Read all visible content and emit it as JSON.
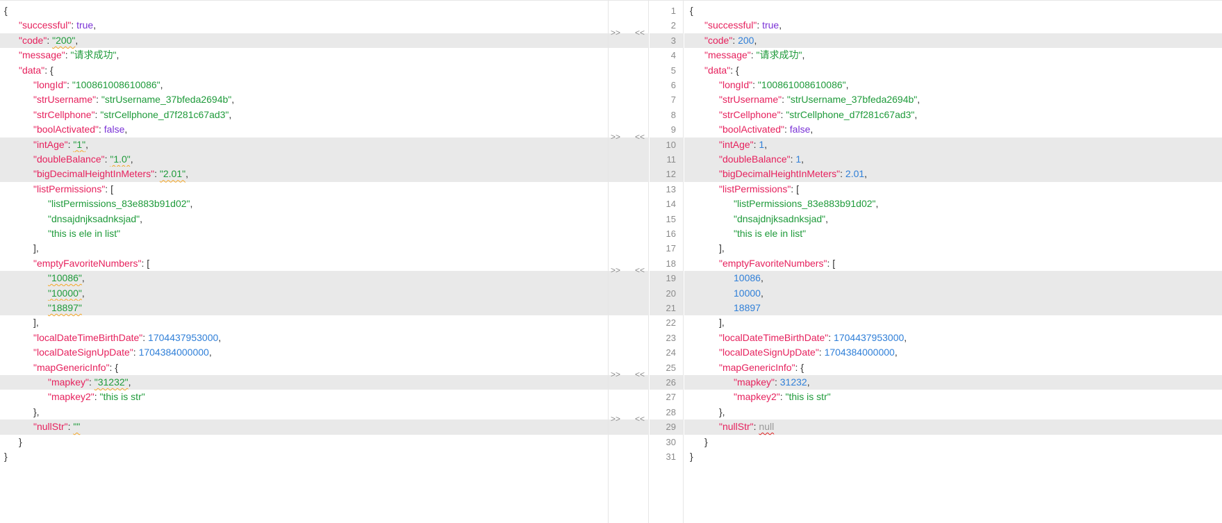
{
  "left_lines": [
    [
      {
        "t": "p",
        "v": "{"
      }
    ],
    [
      {
        "t": "k",
        "v": "\"successful\""
      },
      {
        "t": "p",
        "v": ": "
      },
      {
        "t": "b",
        "v": "true"
      },
      {
        "t": "p",
        "v": ","
      }
    ],
    [
      {
        "t": "k",
        "v": "\"code\""
      },
      {
        "t": "p",
        "v": ": "
      },
      {
        "t": "s",
        "v": "\"200\"",
        "e": "orange"
      },
      {
        "t": "p",
        "v": ","
      }
    ],
    [
      {
        "t": "k",
        "v": "\"message\""
      },
      {
        "t": "p",
        "v": ": "
      },
      {
        "t": "s",
        "v": "\"请求成功\""
      },
      {
        "t": "p",
        "v": ","
      }
    ],
    [
      {
        "t": "k",
        "v": "\"data\""
      },
      {
        "t": "p",
        "v": ": {"
      }
    ],
    [
      {
        "t": "k",
        "v": "\"longId\""
      },
      {
        "t": "p",
        "v": ": "
      },
      {
        "t": "s",
        "v": "\"100861008610086\""
      },
      {
        "t": "p",
        "v": ","
      }
    ],
    [
      {
        "t": "k",
        "v": "\"strUsername\""
      },
      {
        "t": "p",
        "v": ": "
      },
      {
        "t": "s",
        "v": "\"strUsername_37bfeda2694b\""
      },
      {
        "t": "p",
        "v": ","
      }
    ],
    [
      {
        "t": "k",
        "v": "\"strCellphone\""
      },
      {
        "t": "p",
        "v": ": "
      },
      {
        "t": "s",
        "v": "\"strCellphone_d7f281c67ad3\""
      },
      {
        "t": "p",
        "v": ","
      }
    ],
    [
      {
        "t": "k",
        "v": "\"boolActivated\""
      },
      {
        "t": "p",
        "v": ": "
      },
      {
        "t": "b",
        "v": "false"
      },
      {
        "t": "p",
        "v": ","
      }
    ],
    [
      {
        "t": "k",
        "v": "\"intAge\""
      },
      {
        "t": "p",
        "v": ": "
      },
      {
        "t": "s",
        "v": "\"1\"",
        "e": "orange"
      },
      {
        "t": "p",
        "v": ","
      }
    ],
    [
      {
        "t": "k",
        "v": "\"doubleBalance\""
      },
      {
        "t": "p",
        "v": ": "
      },
      {
        "t": "s",
        "v": "\"1.0\"",
        "e": "orange"
      },
      {
        "t": "p",
        "v": ","
      }
    ],
    [
      {
        "t": "k",
        "v": "\"bigDecimalHeightInMeters\""
      },
      {
        "t": "p",
        "v": ": "
      },
      {
        "t": "s",
        "v": "\"2.01\"",
        "e": "orange"
      },
      {
        "t": "p",
        "v": ","
      }
    ],
    [
      {
        "t": "k",
        "v": "\"listPermissions\""
      },
      {
        "t": "p",
        "v": ": ["
      }
    ],
    [
      {
        "t": "s",
        "v": "\"listPermissions_83e883b91d02\""
      },
      {
        "t": "p",
        "v": ","
      }
    ],
    [
      {
        "t": "s",
        "v": "\"dnsajdnjksadnksjad\""
      },
      {
        "t": "p",
        "v": ","
      }
    ],
    [
      {
        "t": "s",
        "v": "\"this is ele in list\""
      }
    ],
    [
      {
        "t": "p",
        "v": "],"
      }
    ],
    [
      {
        "t": "k",
        "v": "\"emptyFavoriteNumbers\""
      },
      {
        "t": "p",
        "v": ": ["
      }
    ],
    [
      {
        "t": "s",
        "v": "\"10086\"",
        "e": "orange"
      },
      {
        "t": "p",
        "v": ","
      }
    ],
    [
      {
        "t": "s",
        "v": "\"10000\"",
        "e": "orange"
      },
      {
        "t": "p",
        "v": ","
      }
    ],
    [
      {
        "t": "s",
        "v": "\"18897\"",
        "e": "orange"
      }
    ],
    [
      {
        "t": "p",
        "v": "],"
      }
    ],
    [
      {
        "t": "k",
        "v": "\"localDateTimeBirthDate\""
      },
      {
        "t": "p",
        "v": ": "
      },
      {
        "t": "n",
        "v": "1704437953000"
      },
      {
        "t": "p",
        "v": ","
      }
    ],
    [
      {
        "t": "k",
        "v": "\"localDateSignUpDate\""
      },
      {
        "t": "p",
        "v": ": "
      },
      {
        "t": "n",
        "v": "1704384000000"
      },
      {
        "t": "p",
        "v": ","
      }
    ],
    [
      {
        "t": "k",
        "v": "\"mapGenericInfo\""
      },
      {
        "t": "p",
        "v": ": {"
      }
    ],
    [
      {
        "t": "k",
        "v": "\"mapkey\""
      },
      {
        "t": "p",
        "v": ": "
      },
      {
        "t": "s",
        "v": "\"31232\"",
        "e": "orange"
      },
      {
        "t": "p",
        "v": ","
      }
    ],
    [
      {
        "t": "k",
        "v": "\"mapkey2\""
      },
      {
        "t": "p",
        "v": ": "
      },
      {
        "t": "s",
        "v": "\"this is str\""
      }
    ],
    [
      {
        "t": "p",
        "v": "},"
      }
    ],
    [
      {
        "t": "k",
        "v": "\"nullStr\""
      },
      {
        "t": "p",
        "v": ": "
      },
      {
        "t": "s",
        "v": "\"\"",
        "e": "orange"
      }
    ],
    [
      {
        "t": "p",
        "v": "}"
      }
    ],
    [
      {
        "t": "p",
        "v": "}"
      }
    ]
  ],
  "right_lines": [
    [
      {
        "t": "p",
        "v": "{"
      }
    ],
    [
      {
        "t": "k",
        "v": "\"successful\""
      },
      {
        "t": "p",
        "v": ": "
      },
      {
        "t": "b",
        "v": "true"
      },
      {
        "t": "p",
        "v": ","
      }
    ],
    [
      {
        "t": "k",
        "v": "\"code\""
      },
      {
        "t": "p",
        "v": ": "
      },
      {
        "t": "n",
        "v": "200"
      },
      {
        "t": "p",
        "v": ","
      }
    ],
    [
      {
        "t": "k",
        "v": "\"message\""
      },
      {
        "t": "p",
        "v": ": "
      },
      {
        "t": "s",
        "v": "\"请求成功\""
      },
      {
        "t": "p",
        "v": ","
      }
    ],
    [
      {
        "t": "k",
        "v": "\"data\""
      },
      {
        "t": "p",
        "v": ": {"
      }
    ],
    [
      {
        "t": "k",
        "v": "\"longId\""
      },
      {
        "t": "p",
        "v": ": "
      },
      {
        "t": "s",
        "v": "\"100861008610086\""
      },
      {
        "t": "p",
        "v": ","
      }
    ],
    [
      {
        "t": "k",
        "v": "\"strUsername\""
      },
      {
        "t": "p",
        "v": ": "
      },
      {
        "t": "s",
        "v": "\"strUsername_37bfeda2694b\""
      },
      {
        "t": "p",
        "v": ","
      }
    ],
    [
      {
        "t": "k",
        "v": "\"strCellphone\""
      },
      {
        "t": "p",
        "v": ": "
      },
      {
        "t": "s",
        "v": "\"strCellphone_d7f281c67ad3\""
      },
      {
        "t": "p",
        "v": ","
      }
    ],
    [
      {
        "t": "k",
        "v": "\"boolActivated\""
      },
      {
        "t": "p",
        "v": ": "
      },
      {
        "t": "b",
        "v": "false"
      },
      {
        "t": "p",
        "v": ","
      }
    ],
    [
      {
        "t": "k",
        "v": "\"intAge\""
      },
      {
        "t": "p",
        "v": ": "
      },
      {
        "t": "n",
        "v": "1"
      },
      {
        "t": "p",
        "v": ","
      }
    ],
    [
      {
        "t": "k",
        "v": "\"doubleBalance\""
      },
      {
        "t": "p",
        "v": ": "
      },
      {
        "t": "n",
        "v": "1"
      },
      {
        "t": "p",
        "v": ","
      }
    ],
    [
      {
        "t": "k",
        "v": "\"bigDecimalHeightInMeters\""
      },
      {
        "t": "p",
        "v": ": "
      },
      {
        "t": "n",
        "v": "2.01"
      },
      {
        "t": "p",
        "v": ","
      }
    ],
    [
      {
        "t": "k",
        "v": "\"listPermissions\""
      },
      {
        "t": "p",
        "v": ": ["
      }
    ],
    [
      {
        "t": "s",
        "v": "\"listPermissions_83e883b91d02\""
      },
      {
        "t": "p",
        "v": ","
      }
    ],
    [
      {
        "t": "s",
        "v": "\"dnsajdnjksadnksjad\""
      },
      {
        "t": "p",
        "v": ","
      }
    ],
    [
      {
        "t": "s",
        "v": "\"this is ele in list\""
      }
    ],
    [
      {
        "t": "p",
        "v": "],"
      }
    ],
    [
      {
        "t": "k",
        "v": "\"emptyFavoriteNumbers\""
      },
      {
        "t": "p",
        "v": ": ["
      }
    ],
    [
      {
        "t": "n",
        "v": "10086"
      },
      {
        "t": "p",
        "v": ","
      }
    ],
    [
      {
        "t": "n",
        "v": "10000"
      },
      {
        "t": "p",
        "v": ","
      }
    ],
    [
      {
        "t": "n",
        "v": "18897"
      }
    ],
    [
      {
        "t": "p",
        "v": "],"
      }
    ],
    [
      {
        "t": "k",
        "v": "\"localDateTimeBirthDate\""
      },
      {
        "t": "p",
        "v": ": "
      },
      {
        "t": "n",
        "v": "1704437953000"
      },
      {
        "t": "p",
        "v": ","
      }
    ],
    [
      {
        "t": "k",
        "v": "\"localDateSignUpDate\""
      },
      {
        "t": "p",
        "v": ": "
      },
      {
        "t": "n",
        "v": "1704384000000"
      },
      {
        "t": "p",
        "v": ","
      }
    ],
    [
      {
        "t": "k",
        "v": "\"mapGenericInfo\""
      },
      {
        "t": "p",
        "v": ": {"
      }
    ],
    [
      {
        "t": "k",
        "v": "\"mapkey\""
      },
      {
        "t": "p",
        "v": ": "
      },
      {
        "t": "n",
        "v": "31232"
      },
      {
        "t": "p",
        "v": ","
      }
    ],
    [
      {
        "t": "k",
        "v": "\"mapkey2\""
      },
      {
        "t": "p",
        "v": ": "
      },
      {
        "t": "s",
        "v": "\"this is str\""
      }
    ],
    [
      {
        "t": "p",
        "v": "},"
      }
    ],
    [
      {
        "t": "k",
        "v": "\"nullStr\""
      },
      {
        "t": "p",
        "v": ": "
      },
      {
        "t": "nul",
        "v": "null",
        "e": "red"
      }
    ],
    [
      {
        "t": "p",
        "v": "}"
      }
    ],
    [
      {
        "t": "p",
        "v": "}"
      }
    ]
  ],
  "indent_levels": [
    0,
    1,
    1,
    1,
    1,
    2,
    2,
    2,
    2,
    2,
    2,
    2,
    2,
    3,
    3,
    3,
    2,
    2,
    3,
    3,
    3,
    2,
    2,
    2,
    2,
    3,
    3,
    2,
    2,
    1,
    0
  ],
  "changed_lines": [
    3,
    10,
    11,
    12,
    19,
    20,
    21,
    26,
    29
  ],
  "line_numbers": [
    "1",
    "2",
    "3",
    "4",
    "5",
    "6",
    "7",
    "8",
    "9",
    "10",
    "11",
    "12",
    "13",
    "14",
    "15",
    "16",
    "17",
    "18",
    "19",
    "20",
    "21",
    "22",
    "23",
    "24",
    "25",
    "26",
    "27",
    "28",
    "29",
    "30",
    "31"
  ],
  "merge_markers": [
    {
      "line": 3,
      "to_right": ">>",
      "to_left": "<<"
    },
    {
      "line": 10,
      "to_right": ">>",
      "to_left": "<<"
    },
    {
      "line": 19,
      "to_right": ">>",
      "to_left": "<<"
    },
    {
      "line": 26,
      "to_right": ">>",
      "to_left": "<<"
    },
    {
      "line": 29,
      "to_right": ">>",
      "to_left": "<<"
    }
  ],
  "colors": {
    "key": "#e6215d",
    "string": "#1e9a3a",
    "number": "#2f7fd8",
    "boolean": "#7a32d6",
    "null": "#999999",
    "changed_bg": "#e9e9e9"
  }
}
